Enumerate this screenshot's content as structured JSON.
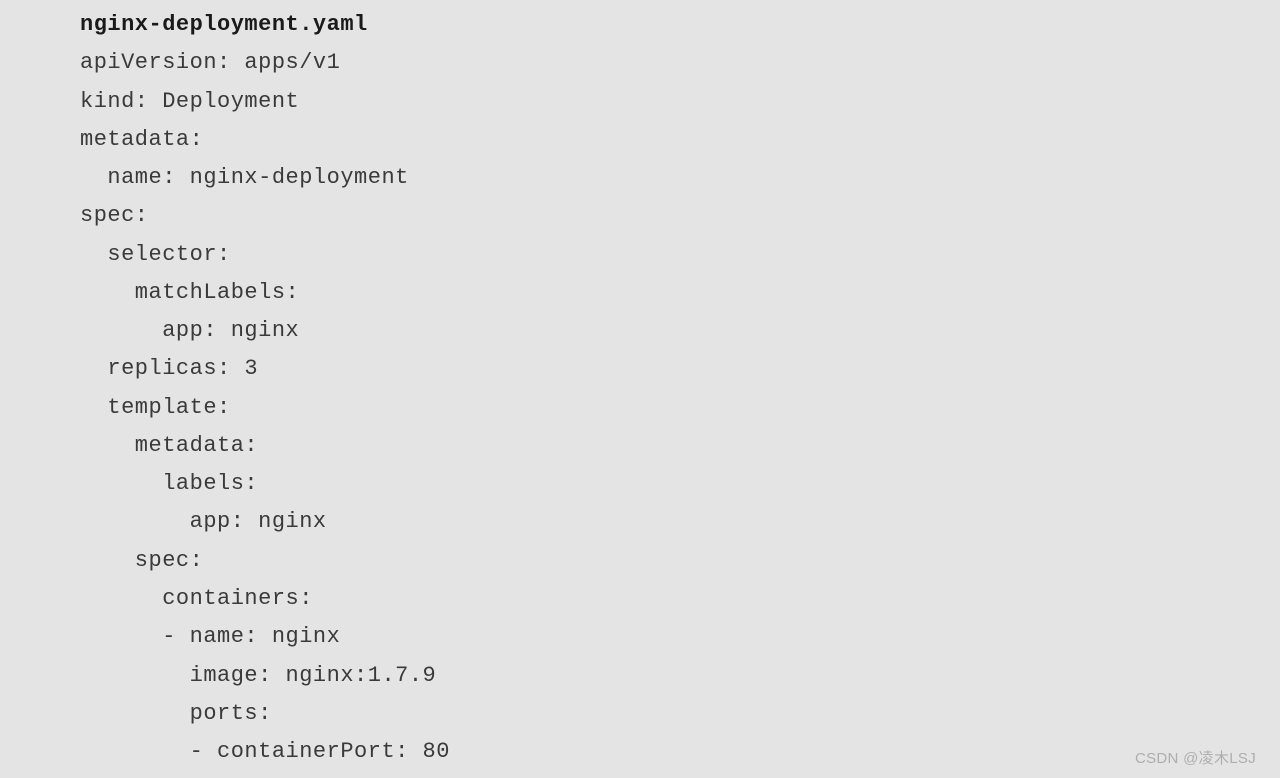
{
  "code": {
    "filename": "nginx-deployment.yaml",
    "lines": [
      "apiVersion: apps/v1",
      "kind: Deployment",
      "metadata:",
      "  name: nginx-deployment",
      "spec:",
      "  selector:",
      "    matchLabels:",
      "      app: nginx",
      "  replicas: 3",
      "  template:",
      "    metadata:",
      "      labels:",
      "        app: nginx",
      "    spec:",
      "      containers:",
      "      - name: nginx",
      "        image: nginx:1.7.9",
      "        ports:",
      "        - containerPort: 80"
    ]
  },
  "watermark": "CSDN @凌木LSJ"
}
